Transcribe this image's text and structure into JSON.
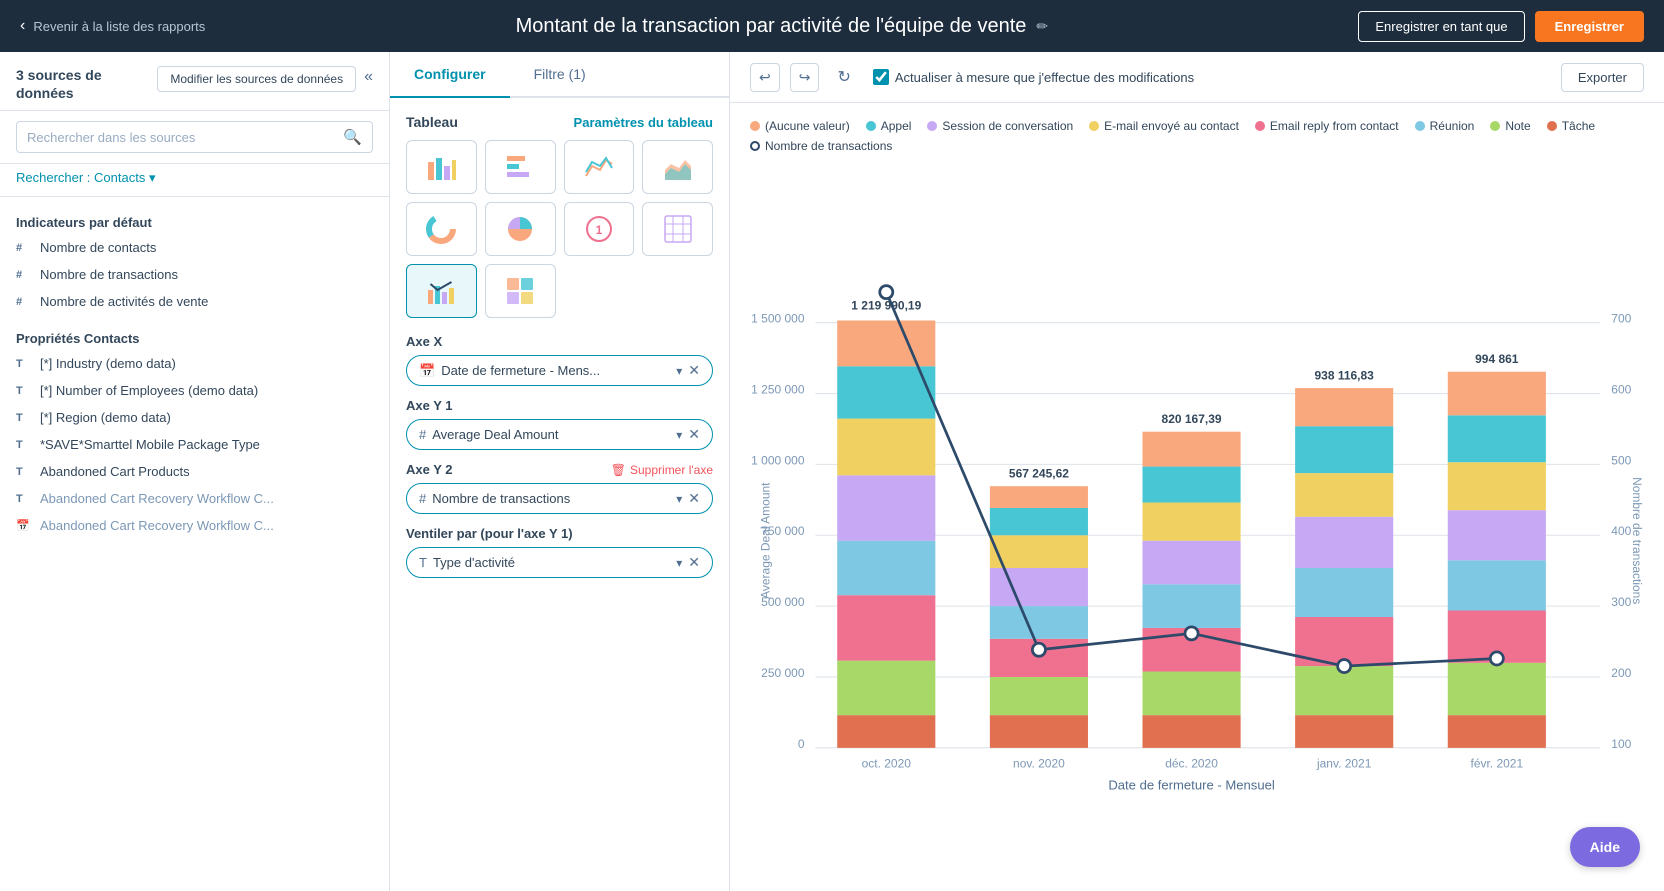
{
  "topbar": {
    "back_label": "Revenir à la liste des rapports",
    "report_title": "Montant de la transaction par activité de l'équipe de vente",
    "save_as_label": "Enregistrer en tant que",
    "save_label": "Enregistrer"
  },
  "left_sidebar": {
    "sources_title": "3 sources de données",
    "modify_btn": "Modifier les sources de données",
    "search_placeholder": "Rechercher dans les sources",
    "search_filter_prefix": "Rechercher :",
    "search_filter_value": "Contacts",
    "sections": [
      {
        "title": "Indicateurs par défaut",
        "items": [
          {
            "type": "#",
            "name": "Nombre de contacts"
          },
          {
            "type": "#",
            "name": "Nombre de transactions"
          },
          {
            "type": "#",
            "name": "Nombre de activités de vente"
          }
        ]
      },
      {
        "title": "Propriétés Contacts",
        "items": [
          {
            "type": "T",
            "name": "[*] Industry (demo data)"
          },
          {
            "type": "T",
            "name": "[*] Number of Employees (demo data)"
          },
          {
            "type": "T",
            "name": "[*] Region (demo data)"
          },
          {
            "type": "T",
            "name": "*SAVE*Smarttel Mobile Package Type"
          },
          {
            "type": "T",
            "name": "Abandoned Cart Products"
          },
          {
            "type": "T",
            "name": "Abandoned Cart Recovery Workflow C..."
          },
          {
            "type": "📅",
            "name": "Abandoned Cart Recovery Workflow C..."
          }
        ]
      }
    ]
  },
  "middle_panel": {
    "tabs": [
      "Configurer",
      "Filtre (1)"
    ],
    "active_tab": "Configurer",
    "tableau_label": "Tableau",
    "params_link": "Paramètres du tableau",
    "axes": {
      "x_label": "Axe X",
      "x_value": "Date de fermeture - Mens...",
      "y1_label": "Axe Y 1",
      "y1_value": "Average Deal Amount",
      "y2_label": "Axe Y 2",
      "y2_value": "Nombre de transactions",
      "y2_delete": "Supprimer l'axe"
    },
    "ventiler_label": "Ventiler par (pour l'axe Y 1)",
    "ventiler_value": "Type d'activité"
  },
  "chart": {
    "toolbar": {
      "undo_title": "Annuler",
      "redo_title": "Rétablir",
      "refresh_title": "Actualiser",
      "auto_refresh_label": "Actualiser à mesure que j'effectue des modifications",
      "export_label": "Exporter"
    },
    "legend": [
      {
        "label": "(Aucune valeur)",
        "color": "#f9a87d"
      },
      {
        "label": "Appel",
        "color": "#49c6d4"
      },
      {
        "label": "Session de conversation",
        "color": "#c7a8f5"
      },
      {
        "label": "E-mail envoyé au contact",
        "color": "#f0d060"
      },
      {
        "label": "Email reply from contact",
        "color": "#f07090"
      },
      {
        "label": "Réunion",
        "color": "#7ec8e3"
      },
      {
        "label": "Note",
        "color": "#a8d868"
      },
      {
        "label": "Tâche",
        "color": "#e07050"
      },
      {
        "label": "Nombre de transactions",
        "color": "#2d4a6a",
        "circle": true
      }
    ],
    "y_axis_left_label": "Average Deal Amount",
    "y_axis_right_label": "Nombre de transactions",
    "x_axis_label": "Date de fermeture - Mensuel",
    "bars": [
      {
        "month": "oct. 2020",
        "value": 1219990.19,
        "label": "1 219 990,19",
        "height_pct": 95
      },
      {
        "month": "nov. 2020",
        "value": 567245.62,
        "label": "567 245,62",
        "height_pct": 44
      },
      {
        "month": "déc. 2020",
        "value": 820167.39,
        "label": "820 167,39",
        "height_pct": 63
      },
      {
        "month": "janv. 2021",
        "value": 938116.83,
        "label": "938 116,83",
        "height_pct": 72
      },
      {
        "month": "févr. 2021",
        "value": 994861,
        "label": "994 861",
        "height_pct": 77
      }
    ],
    "line_points": [
      {
        "x_pct": 10,
        "y_pct": 5
      },
      {
        "x_pct": 30,
        "y_pct": 72
      },
      {
        "x_pct": 50,
        "y_pct": 60
      },
      {
        "x_pct": 70,
        "y_pct": 82
      },
      {
        "x_pct": 90,
        "y_pct": 78
      }
    ],
    "y_left_ticks": [
      "0",
      "250 000",
      "500 000",
      "750 000",
      "1 000 000",
      "1 250 000",
      "1 500 000"
    ],
    "y_right_ticks": [
      "100",
      "200",
      "300",
      "400",
      "500",
      "600",
      "700"
    ]
  },
  "aide_label": "Aide"
}
